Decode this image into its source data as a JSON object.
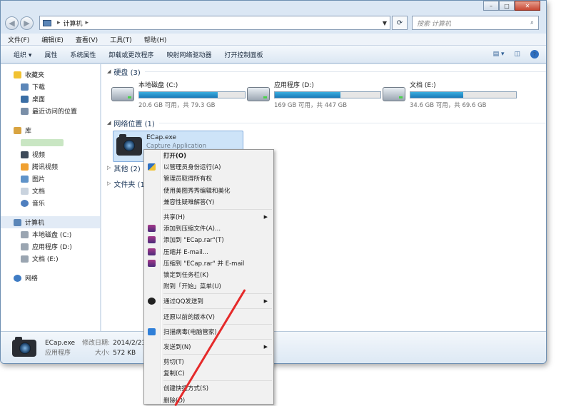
{
  "window": {
    "controls": [
      "–",
      "□",
      "✕"
    ]
  },
  "address": {
    "path": "计算机",
    "search_placeholder": "搜索 计算机"
  },
  "menubar": [
    "文件(F)",
    "编辑(E)",
    "查看(V)",
    "工具(T)",
    "帮助(H)"
  ],
  "toolbar": [
    "组织 ▾",
    "属性",
    "系统属性",
    "卸载或更改程序",
    "映射网络驱动器",
    "打开控制面板"
  ],
  "sidebar": {
    "favorites": "收藏夹",
    "fav_items": [
      "下载",
      "桌面",
      "最近访问的位置"
    ],
    "libraries": "库",
    "lib_items": [
      "视频",
      "腾讯视频",
      "图片",
      "文档",
      "音乐"
    ],
    "computer": "计算机",
    "computer_items": [
      "本地磁盘 (C:)",
      "应用程序 (D:)",
      "文档 (E:)"
    ],
    "network": "网络"
  },
  "main": {
    "hdd_group": "硬盘 (3)",
    "drives": [
      {
        "name": "本地磁盘 (C:)",
        "size": "20.6 GB 可用，共 79.3 GB",
        "used": 0.74
      },
      {
        "name": "应用程序 (D:)",
        "size": "169 GB 可用，共 447 GB",
        "used": 0.62
      },
      {
        "name": "文档 (E:)",
        "size": "34.6 GB 可用，共 69.6 GB",
        "used": 0.5
      }
    ],
    "net_group": "网络位置 (1)",
    "net_item": {
      "name": "ECap.exe",
      "desc": "Capture Application",
      "extra": "1."
    },
    "other_group": "其他 (2)",
    "folder_group": "文件夹 (1"
  },
  "status": {
    "name": "ECap.exe",
    "type": "应用程序",
    "modified_label": "修改日期:",
    "modified": "2014/2/23 1",
    "size_label": "大小:",
    "size": "572 KB"
  },
  "context_menu": {
    "open": "打开(O)",
    "run_admin": "以管理员身份运行(A)",
    "take_owner": "管理员取得所有权",
    "meitu": "使用美图秀秀编辑和美化",
    "compat": "兼容性疑难解答(Y)",
    "share": "共享(H)",
    "add_archive": "添加到压缩文件(A)...",
    "add_rar": "添加到 \"ECap.rar\"(T)",
    "compress_email": "压缩并 E-mail...",
    "compress_rar_email": "压缩到 \"ECap.rar\" 并 E-mail",
    "pin_taskbar": "锁定到任务栏(K)",
    "pin_start": "附到「开始」菜单(U)",
    "qq_send": "通过QQ发送到",
    "restore": "还原以前的版本(V)",
    "scan": "扫描病毒(电脑管家)",
    "send_to": "发送到(N)",
    "cut": "剪切(T)",
    "copy": "复制(C)",
    "shortcut": "创建快捷方式(S)",
    "delete": "删除(D)"
  },
  "colors": {
    "selection": "#cde3f8",
    "annotation": "#e52a2a"
  }
}
